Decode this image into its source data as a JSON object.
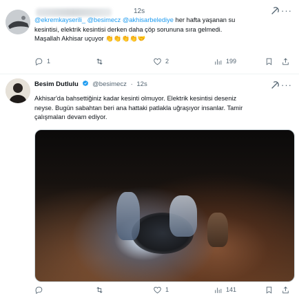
{
  "tweet1": {
    "time": "12s",
    "text": {
      "mentions": "@ekremkayserili_ @besimecz @akhisarbelediye",
      "line1_rest": " her hafta yaşanan su",
      "line2": "kesintisi, elektrik kesintisi derken daha çöp sorununa sıra gelmedi.",
      "line3": "Maşallah Akhisar uçuyor 👏👏👏👏🤝"
    },
    "actions": {
      "reply_count": "1",
      "retweet_count": "",
      "like_count": "2",
      "view_count": "199"
    }
  },
  "tweet2": {
    "author_name": "Besim Dutlulu",
    "handle": "@besimecz",
    "time": "12s",
    "text": {
      "line1": "Akhisar'da bahsettiğiniz kadar kesinti olmuyor. Elektrik kesintisi deseniz",
      "line2": "neyse. Bugün sabahtan beri ana hattaki patlakla uğraşıyor insanlar. Tamir",
      "line3": "çalışmaları devam ediyor."
    },
    "actions": {
      "reply_count": "",
      "retweet_count": "",
      "like_count": "1",
      "view_count": "141"
    }
  },
  "colors": {
    "link": "#1d9bf0",
    "muted": "#536471",
    "verified": "#1d9bf0"
  },
  "icons": [
    "grok-icon",
    "more-icon",
    "reply-icon",
    "retweet-icon",
    "like-icon",
    "views-icon",
    "bookmark-icon",
    "share-icon",
    "verified-badge-icon"
  ]
}
